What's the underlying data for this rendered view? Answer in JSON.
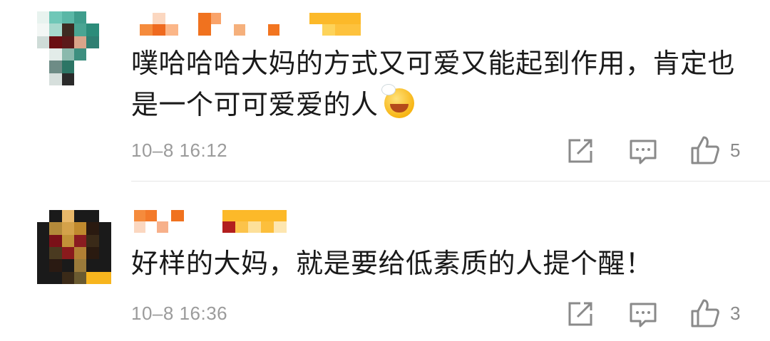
{
  "comments": [
    {
      "text": "噗哈哈哈大妈的方式又可爱又能起到作用，肯定也是一个可可爱爱的人",
      "emoji": "grinning-face-emoji",
      "time": "10–8 16:12",
      "likes": "5"
    },
    {
      "text": "好样的大妈，就是要给低素质的人提个醒！",
      "time": "10–8 16:36",
      "likes": "3"
    }
  ],
  "icons": {
    "share": "share-icon",
    "reply": "comment-icon",
    "like": "thumbs-up-icon"
  },
  "colors": {
    "text": "#1a1a1a",
    "meta": "#9b9b9b",
    "icon": "#8a8a8a",
    "divider": "#e6e6e6"
  }
}
